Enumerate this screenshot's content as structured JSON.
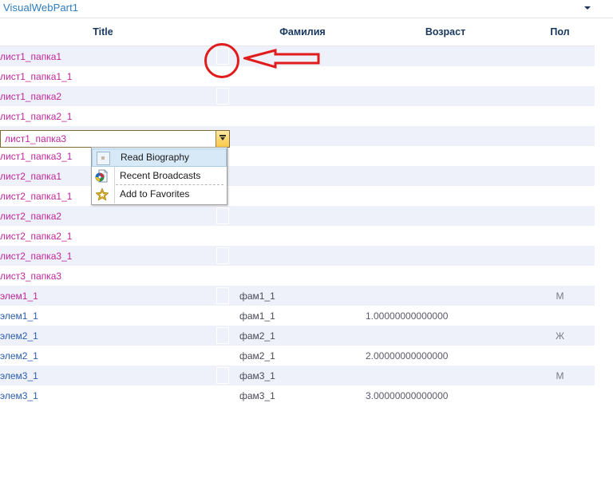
{
  "webpart": {
    "title": "VisualWebPart1",
    "menu_arrow_icon": "chevron-down-icon"
  },
  "table": {
    "columns": [
      "Title",
      "",
      "Фамилия",
      "Возраст",
      "Пол"
    ],
    "headers": {
      "title": "Title",
      "familia": "Фамилия",
      "vozrast": "Возраст",
      "pol": "Пол"
    },
    "rows": [
      {
        "title": "лист1_папка1",
        "link_state": "visited",
        "has_image": true,
        "familia": "",
        "vozrast": "",
        "pol": ""
      },
      {
        "title": "лист1_папка1_1",
        "link_state": "visited",
        "has_image": false,
        "familia": "",
        "vozrast": "",
        "pol": ""
      },
      {
        "title": "лист1_папка2",
        "link_state": "visited",
        "has_image": true,
        "familia": "",
        "vozrast": "",
        "pol": ""
      },
      {
        "title": "лист1_папка2_1",
        "link_state": "visited",
        "has_image": false,
        "familia": "",
        "vozrast": "",
        "pol": ""
      },
      {
        "title": "лист1_папка3",
        "link_state": "visited",
        "has_image": false,
        "familia": "",
        "vozrast": "",
        "pol": "",
        "selected": true
      },
      {
        "title": "лист1_папка3_1",
        "link_state": "visited",
        "has_image": false,
        "familia": "",
        "vozrast": "",
        "pol": ""
      },
      {
        "title": "лист2_папка1",
        "link_state": "visited",
        "has_image": true,
        "familia": "",
        "vozrast": "",
        "pol": ""
      },
      {
        "title": "лист2_папка1_1",
        "link_state": "visited",
        "has_image": false,
        "familia": "",
        "vozrast": "",
        "pol": ""
      },
      {
        "title": "лист2_папка2",
        "link_state": "visited",
        "has_image": true,
        "familia": "",
        "vozrast": "",
        "pol": ""
      },
      {
        "title": "лист2_папка2_1",
        "link_state": "visited",
        "has_image": false,
        "familia": "",
        "vozrast": "",
        "pol": ""
      },
      {
        "title": "лист2_папка3_1",
        "link_state": "visited",
        "has_image": true,
        "familia": "",
        "vozrast": "",
        "pol": ""
      },
      {
        "title": "лист3_папка3",
        "link_state": "visited",
        "has_image": false,
        "familia": "",
        "vozrast": "",
        "pol": ""
      },
      {
        "title": "элем1_1",
        "link_state": "visited",
        "has_image": true,
        "familia": "фам1_1",
        "vozrast": "",
        "pol": "М"
      },
      {
        "title": "элем1_1",
        "link_state": "unvisited",
        "has_image": false,
        "familia": "фам1_1",
        "vozrast": "1.00000000000000",
        "pol": ""
      },
      {
        "title": "элем2_1",
        "link_state": "unvisited",
        "has_image": true,
        "familia": "фам2_1",
        "vozrast": "",
        "pol": "Ж"
      },
      {
        "title": "элем2_1",
        "link_state": "unvisited",
        "has_image": false,
        "familia": "фам2_1",
        "vozrast": "2.00000000000000",
        "pol": ""
      },
      {
        "title": "элем3_1",
        "link_state": "unvisited",
        "has_image": true,
        "familia": "фам3_1",
        "vozrast": "",
        "pol": "М"
      },
      {
        "title": "элем3_1",
        "link_state": "unvisited",
        "has_image": false,
        "familia": "фам3_1",
        "vozrast": "3.00000000000000",
        "pol": ""
      }
    ]
  },
  "selected_row": {
    "value": "лист1_папка3",
    "dropdown_icon": "dropdown-caret-icon"
  },
  "context_menu": {
    "items": [
      {
        "label": "Read Biography",
        "icon": "blank-page-icon",
        "highlighted": true,
        "separator_after": false
      },
      {
        "label": "Recent Broadcasts",
        "icon": "browser-document-icon",
        "highlighted": false,
        "separator_after": true
      },
      {
        "label": "Add to Favorites",
        "icon": "star-icon",
        "highlighted": false,
        "separator_after": false
      }
    ]
  },
  "annotations": {
    "circle": {
      "name": "red-circle-annotation"
    },
    "arrow": {
      "name": "red-arrow-annotation",
      "direction": "left"
    }
  },
  "colors": {
    "link_visited": "#c0269c",
    "link_unvisited": "#2a5db0",
    "header_text": "#17375e",
    "webpart_title": "#2b7cc1",
    "row_alt": "#eef1fa",
    "annotation_red": "#e01b1b",
    "select_border": "#7f6a33"
  }
}
